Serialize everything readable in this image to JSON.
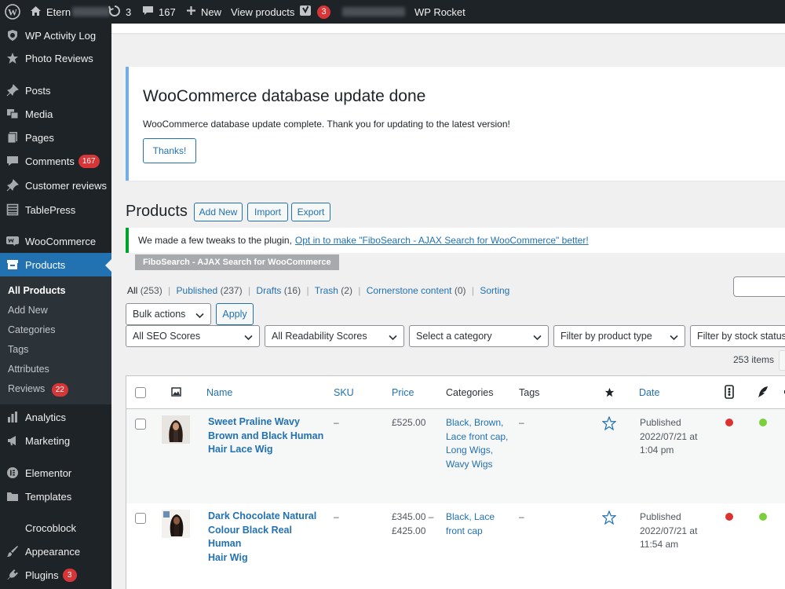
{
  "admin_bar": {
    "site_name": "Etern",
    "updates_count": "3",
    "comments_count": "167",
    "new_label": "New",
    "view_products_label": "View products",
    "yoast_count": "3",
    "wp_rocket_label": "WP Rocket"
  },
  "sidebar": {
    "items": [
      {
        "label": "WP Activity Log",
        "icon": "shield-icon"
      },
      {
        "label": "Photo Reviews",
        "icon": "star-icon"
      },
      {
        "label": "Posts",
        "icon": "pin-icon"
      },
      {
        "label": "Media",
        "icon": "media-icon"
      },
      {
        "label": "Pages",
        "icon": "pages-icon"
      },
      {
        "label": "Comments",
        "icon": "comment-icon",
        "badge": "167"
      },
      {
        "label": "Customer reviews",
        "icon": "pin-icon"
      },
      {
        "label": "TablePress",
        "icon": "table-icon"
      },
      {
        "label": "WooCommerce",
        "icon": "woo-icon"
      },
      {
        "label": "Products",
        "icon": "archive-icon"
      },
      {
        "label": "Analytics",
        "icon": "bar-chart-icon"
      },
      {
        "label": "Marketing",
        "icon": "megaphone-icon"
      },
      {
        "label": "Elementor",
        "icon": "elementor-icon"
      },
      {
        "label": "Templates",
        "icon": "folder-icon"
      },
      {
        "label": "Crocoblock",
        "icon": ""
      },
      {
        "label": "Appearance",
        "icon": "brush-icon"
      },
      {
        "label": "Plugins",
        "icon": "plug-icon",
        "badge": "3"
      }
    ],
    "submenu": [
      {
        "label": "All Products"
      },
      {
        "label": "Add New"
      },
      {
        "label": "Categories"
      },
      {
        "label": "Tags"
      },
      {
        "label": "Attributes"
      },
      {
        "label": "Reviews",
        "badge": "22"
      }
    ]
  },
  "notice_update": {
    "title": "WooCommerce database update done",
    "text": "WooCommerce database update complete. Thank you for updating to the latest version!",
    "button": "Thanks!"
  },
  "page": {
    "title": "Products",
    "add_new": "Add New",
    "import": "Import",
    "export": "Export"
  },
  "fibo_notice": {
    "text": "We made a few tweaks to the plugin,",
    "link": "Opt in to make \"FiboSearch - AJAX Search for WooCommerce\" better!",
    "tag": "FiboSearch - AJAX Search for WooCommerce"
  },
  "views": {
    "all": "All",
    "all_count": "(253)",
    "published": "Published",
    "published_count": "(237)",
    "drafts": "Drafts",
    "drafts_count": "(16)",
    "trash": "Trash",
    "trash_count": "(2)",
    "cornerstone": "Cornerstone content",
    "cornerstone_count": "(0)",
    "sorting": "Sorting",
    "separator": "|"
  },
  "filters": {
    "bulk_actions": "Bulk actions",
    "apply": "Apply",
    "seo": "All SEO Scores",
    "readability": "All Readability Scores",
    "category": "Select a category",
    "product_type": "Filter by product type",
    "stock": "Filter by stock status",
    "items_count": "253 items"
  },
  "table": {
    "columns": {
      "name": "Name",
      "sku": "SKU",
      "price": "Price",
      "categories": "Categories",
      "tags": "Tags",
      "date": "Date"
    },
    "rows": [
      {
        "name": [
          "Sweet Praline Wavy",
          "Brown and Black Human",
          "Hair Lace Wig"
        ],
        "sku": "–",
        "price": [
          "£525.00"
        ],
        "categories": [
          "Black, Brown,",
          "Lace front cap,",
          "Long Wigs,",
          "Wavy Wigs"
        ],
        "tags": "–",
        "date": [
          "Published",
          "2022/07/21 at",
          "1:04 pm"
        ],
        "seo_color": "#dc3232",
        "readability_color": "#7ad03a"
      },
      {
        "name": [
          "Dark Chocolate Natural",
          "Colour Black Real Human",
          "Hair Wig"
        ],
        "sku": "–",
        "price": [
          "£345.00 –",
          "£425.00"
        ],
        "categories": [
          "Black, Lace",
          "front cap"
        ],
        "tags": "–",
        "date": [
          "Published",
          "2022/07/21 at",
          "11:54 am"
        ],
        "seo_color": "#dc3232",
        "readability_color": "#7ad03a"
      }
    ]
  }
}
